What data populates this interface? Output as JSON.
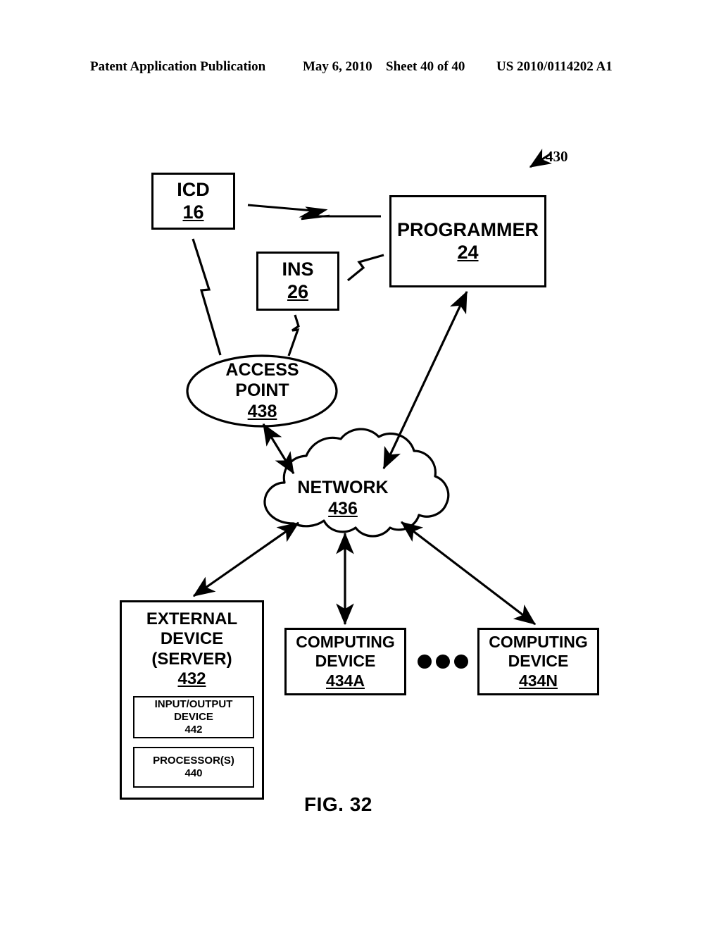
{
  "header": {
    "publication": "Patent Application Publication",
    "date": "May 6, 2010",
    "sheet": "Sheet 40 of 40",
    "patent_number": "US 2010/0114202 A1"
  },
  "figure": {
    "caption": "FIG. 32",
    "system_reference": "430",
    "nodes": {
      "icd": {
        "label": "ICD",
        "ref": "16"
      },
      "ins": {
        "label": "INS",
        "ref": "26"
      },
      "programmer": {
        "label": "PROGRAMMER",
        "ref": "24"
      },
      "access_point": {
        "label_line1": "ACCESS",
        "label_line2": "POINT",
        "ref": "438"
      },
      "network": {
        "label": "NETWORK",
        "ref": "436"
      },
      "external_device": {
        "label_line1": "EXTERNAL",
        "label_line2": "DEVICE",
        "label_line3": "(SERVER)",
        "ref": "432",
        "sub_io": {
          "label_line1": "INPUT/OUTPUT",
          "label_line2": "DEVICE",
          "ref": "442"
        },
        "sub_processor": {
          "label": "PROCESSOR(S)",
          "ref": "440"
        }
      },
      "computing_device_a": {
        "label_line1": "COMPUTING",
        "label_line2": "DEVICE",
        "ref": "434A"
      },
      "computing_device_n": {
        "label_line1": "COMPUTING",
        "label_line2": "DEVICE",
        "ref": "434N"
      }
    },
    "connections": [
      {
        "from": "icd",
        "to": "programmer",
        "style": "wireless-bolt"
      },
      {
        "from": "ins",
        "to": "programmer",
        "style": "wireless-bolt"
      },
      {
        "from": "icd",
        "to": "access_point",
        "style": "wireless-bolt"
      },
      {
        "from": "ins",
        "to": "access_point",
        "style": "wireless-bolt"
      },
      {
        "from": "access_point",
        "to": "network",
        "style": "double-arrow"
      },
      {
        "from": "programmer",
        "to": "network",
        "style": "double-arrow"
      },
      {
        "from": "network",
        "to": "external_device",
        "style": "double-arrow"
      },
      {
        "from": "network",
        "to": "computing_device_a",
        "style": "double-arrow"
      },
      {
        "from": "network",
        "to": "computing_device_n",
        "style": "double-arrow"
      }
    ],
    "ellipsis_dot_count": 3,
    "colors": {
      "ink": "#000000",
      "background": "#ffffff"
    }
  }
}
